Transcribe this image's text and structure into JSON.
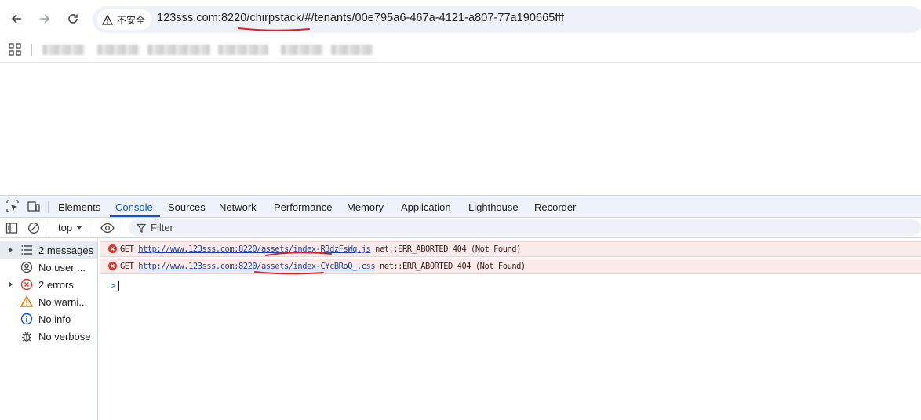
{
  "browser": {
    "security_label": "不安全",
    "url": {
      "host": "123sss.com:8220/",
      "path_highlight": "chirpstack/",
      "rest": "#/tenants/00e795a6-467a-4121-a807-77a190665fff"
    }
  },
  "devtools": {
    "tabs": [
      "Elements",
      "Console",
      "Sources",
      "Network",
      "Performance",
      "Memory",
      "Application",
      "Lighthouse",
      "Recorder"
    ],
    "active_tab": "Console",
    "context": "top",
    "filter_placeholder": "Filter",
    "sidebar": [
      {
        "label": "2 messages",
        "icon": "list-icon",
        "expandable": true,
        "selected": true
      },
      {
        "label": "No user ...",
        "icon": "user-icon",
        "expandable": false,
        "selected": false
      },
      {
        "label": "2 errors",
        "icon": "error-icon",
        "expandable": true,
        "selected": false
      },
      {
        "label": "No warni...",
        "icon": "warning-icon",
        "expandable": false,
        "selected": false
      },
      {
        "label": "No info",
        "icon": "info-icon",
        "expandable": false,
        "selected": false
      },
      {
        "label": "No verbose",
        "icon": "bug-icon",
        "expandable": false,
        "selected": false
      }
    ],
    "messages": [
      {
        "method": "GET",
        "url": "http://www.123sss.com:8220/assets/index-R3dzFsWq.js",
        "status": "net::ERR_ABORTED 404 (Not Found)"
      },
      {
        "method": "GET",
        "url": "http://www.123sss.com:8220/assets/index-CYcBRoQ_.css",
        "status": "net::ERR_ABORTED 404 (Not Found)"
      }
    ],
    "prompt_symbol": ">"
  },
  "colors": {
    "accent": "#0b57d0",
    "error_bg": "#fcebeb",
    "error_text": "#b3261e",
    "annotation_red": "#e02020"
  }
}
